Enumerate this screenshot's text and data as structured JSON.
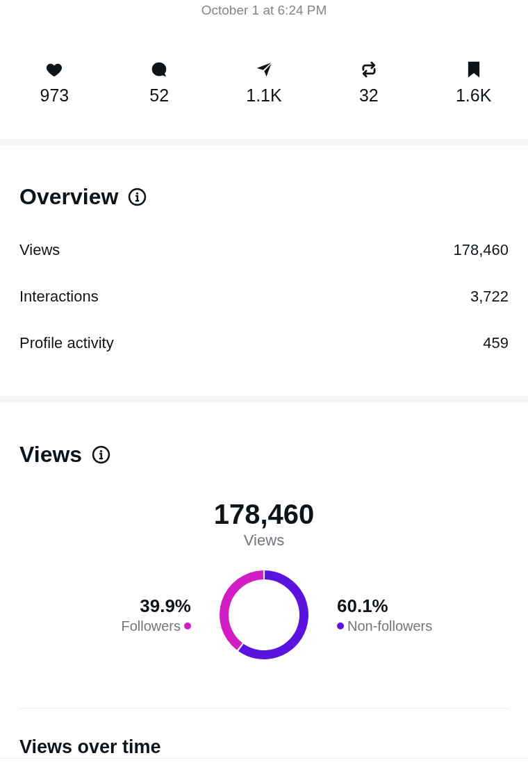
{
  "timestamp": "October 1 at 6:24 PM",
  "stats": [
    {
      "kind": "like",
      "count": "973"
    },
    {
      "kind": "reply",
      "count": "52"
    },
    {
      "kind": "share",
      "count": "1.1K"
    },
    {
      "kind": "repost",
      "count": "32"
    },
    {
      "kind": "bookmark",
      "count": "1.6K"
    }
  ],
  "overview": {
    "title": "Overview",
    "rows": [
      {
        "label": "Views",
        "value": "178,460"
      },
      {
        "label": "Interactions",
        "value": "3,722"
      },
      {
        "label": "Profile activity",
        "value": "459"
      }
    ]
  },
  "views": {
    "title": "Views",
    "total": "178,460",
    "total_label": "Views",
    "breakdown": [
      {
        "percent": "39.9%",
        "color": "#d21cc4"
      },
      {
        "percent": "60.1%",
        "color": "#5b14df"
      }
    ],
    "chart_data": {
      "type": "donut",
      "categories": [
        "Followers",
        "Non-followers"
      ],
      "values": [
        39.9,
        60.1
      ]
    }
  },
  "views_over_time": {
    "title": "Views over time"
  }
}
